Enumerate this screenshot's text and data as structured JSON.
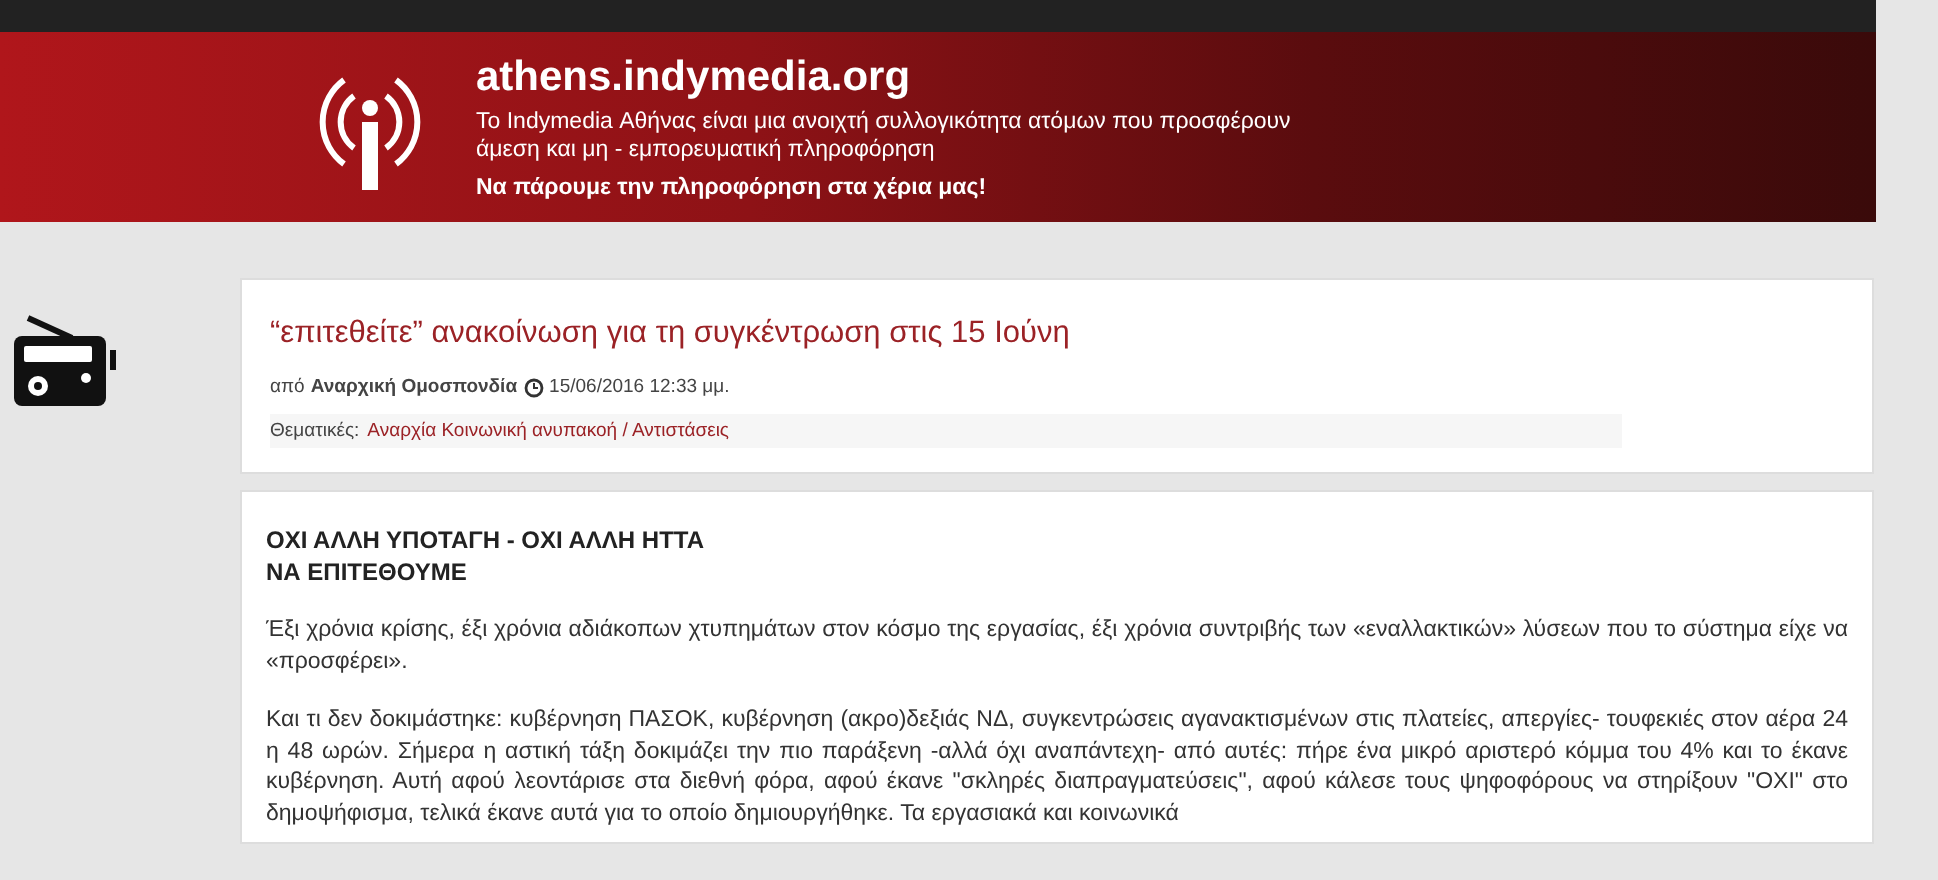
{
  "banner": {
    "site": "athens.indymedia.org",
    "tagline": "Το Indymedia Αθήνας είναι μια ανοιχτή συλλογικότητα ατόμων που προσφέρουν άμεση και μη - εμπορευματική πληροφόρηση",
    "slogan": "Να πάρουμε την πληροφόρηση στα χέρια μας!"
  },
  "article": {
    "title": "“επιτεθείτε” ανακοίνωση για τη συγκέντρωση στις 15 Ιούνη",
    "by_label": "από",
    "author": "Αναρχική Ομοσπονδία",
    "date": "15/06/2016 12:33 μμ.",
    "topics_label": "Θεματικές:",
    "topics": "Αναρχία Κοινωνική ανυπακοή / Αντιστάσεις",
    "heading_lines": [
      "ΟΧΙ ΑΛΛΗ ΥΠΟΤΑΓΗ - ΟΧΙ ΑΛΛΗ ΗΤΤΑ",
      "ΝΑ ΕΠΙΤΕΘΟΥΜΕ"
    ],
    "paragraphs": [
      "Έξι χρόνια κρίσης, έξι χρόνια αδιάκοπων χτυπημάτων στον κόσμο της εργασίας, έξι χρόνια συντριβής των «εναλλακτικών» λύσεων που το σύστημα είχε να «προσφέρει».",
      "Και τι δεν δοκιμάστηκε: κυβέρνηση ΠΑΣΟΚ, κυβέρνηση (ακρο)δεξιάς ΝΔ, συγκεντρώσεις αγανακτισμένων στις πλατείες, απεργίες- τουφεκιές στον αέρα 24 η 48 ωρών. Σήμερα η αστική τάξη  δοκιμάζει την πιο παράξενη -αλλά όχι αναπάντεχη- από αυτές: πήρε ένα μικρό αριστερό κόμμα του 4% και το έκανε κυβέρνηση. Αυτή αφού λεοντάρισε στα διεθνή φόρα, αφού έκανε \"σκληρές διαπραγματεύσεις\", αφού κάλεσε τους ψηφοφόρους να στηρίξουν \"ΟΧΙ\" στο δημοψήφισμα, τελικά έκανε αυτά για το οποίο δημιουργήθηκε. Τα εργασιακά και κοινωνικά"
    ]
  }
}
